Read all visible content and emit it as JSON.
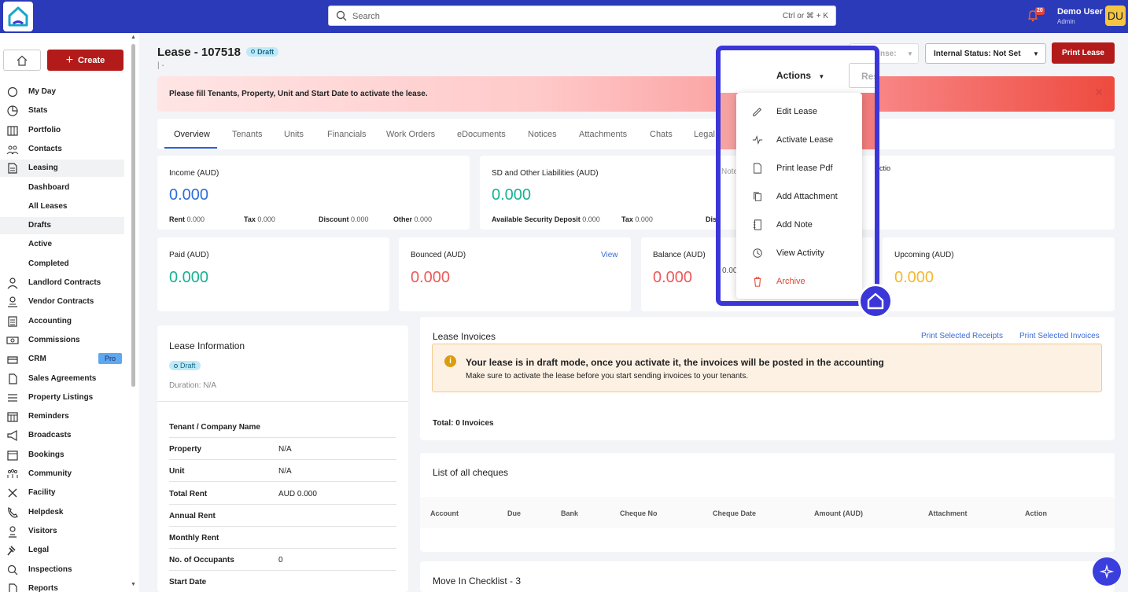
{
  "search": {
    "placeholder": "Search",
    "shortcut": "Ctrl or ⌘ + K"
  },
  "notifications": {
    "count": "20"
  },
  "user": {
    "name": "Demo User",
    "role": "Admin",
    "initials": "DU"
  },
  "sidebar": {
    "create_label": "Create",
    "items": [
      {
        "label": "My Day",
        "icon": "sun-icon"
      },
      {
        "label": "Stats",
        "icon": "pie-chart-icon"
      },
      {
        "label": "Portfolio",
        "icon": "building-icon"
      },
      {
        "label": "Contacts",
        "icon": "contacts-icon"
      },
      {
        "label": "Leasing",
        "icon": "document-icon",
        "selected": true
      },
      {
        "label": "Dashboard"
      },
      {
        "label": "All Leases"
      },
      {
        "label": "Drafts",
        "selected": true
      },
      {
        "label": "Active"
      },
      {
        "label": "Completed"
      },
      {
        "label": "Landlord Contracts",
        "icon": "landlord-icon"
      },
      {
        "label": "Vendor Contracts",
        "icon": "vendor-icon"
      },
      {
        "label": "Accounting",
        "icon": "ledger-icon"
      },
      {
        "label": "Commissions",
        "icon": "cash-icon"
      },
      {
        "label": "CRM",
        "icon": "crm-icon",
        "badge": "Pro"
      },
      {
        "label": "Sales Agreements",
        "icon": "file-icon"
      },
      {
        "label": "Property Listings",
        "icon": "list-icon"
      },
      {
        "label": "Reminders",
        "icon": "calendar-icon"
      },
      {
        "label": "Broadcasts",
        "icon": "megaphone-icon"
      },
      {
        "label": "Bookings",
        "icon": "booking-icon"
      },
      {
        "label": "Community",
        "icon": "community-icon"
      },
      {
        "label": "Facility",
        "icon": "tools-icon"
      },
      {
        "label": "Helpdesk",
        "icon": "phone-icon"
      },
      {
        "label": "Visitors",
        "icon": "visitor-icon"
      },
      {
        "label": "Legal",
        "icon": "gavel-icon"
      },
      {
        "label": "Inspections",
        "icon": "magnifier-icon"
      },
      {
        "label": "Reports",
        "icon": "report-icon"
      }
    ]
  },
  "header": {
    "title": "Lease - 107518",
    "status": "Draft",
    "subtitle": "| -",
    "license_label": "nse:",
    "internal_status": "Internal Status: Not Set",
    "print_label": "Print Lease",
    "actions_label": "Actions",
    "res_label": "Res"
  },
  "alert": {
    "text": "Please fill Tenants, Property, Unit and Start Date to activate the lease."
  },
  "tabs": [
    "Overview",
    "Tenants",
    "Units",
    "Financials",
    "Work Orders",
    "eDocuments",
    "Notices",
    "Attachments",
    "Chats",
    "Legal"
  ],
  "income": {
    "title": "Income (AUD)",
    "value": "0.000",
    "rent_label": "Rent",
    "rent": "0.000",
    "tax_label": "Tax",
    "tax": "0.000",
    "discount_label": "Discount",
    "discount": "0.000",
    "other_label": "Other",
    "other": "0.000"
  },
  "sd": {
    "title": "SD and Other Liabilities (AUD)",
    "value": "0.000",
    "available_label": "Available Security Deposit",
    "available": "0.000",
    "tax_label": "Tax",
    "tax": "0.000",
    "dis_label": "Dis"
  },
  "third": {
    "note_fragment": "Note",
    "action_fragment": "ctio",
    "paren_fragment": ")"
  },
  "paid": {
    "title": "Paid (AUD)",
    "value": "0.000"
  },
  "bounced": {
    "title": "Bounced (AUD)",
    "value": "0.000",
    "view": "View"
  },
  "balance": {
    "title": "Balance (AUD)",
    "value": "0.000",
    "frag": "0.00"
  },
  "upcoming": {
    "title": "Upcoming (AUD)",
    "value": "0.000"
  },
  "lease_info": {
    "title": "Lease Information",
    "status": "Draft",
    "duration": "Duration: N/A",
    "rows": [
      {
        "k": "Tenant / Company Name",
        "v": ""
      },
      {
        "k": "Property",
        "v": "N/A"
      },
      {
        "k": "Unit",
        "v": "N/A"
      },
      {
        "k": "Total Rent",
        "v": "AUD 0.000"
      },
      {
        "k": "Annual Rent",
        "v": ""
      },
      {
        "k": "Monthly Rent",
        "v": ""
      },
      {
        "k": "No. of Occupants",
        "v": "0"
      },
      {
        "k": "Start Date",
        "v": ""
      }
    ]
  },
  "invoices": {
    "title": "Lease Invoices",
    "print_receipts": "Print Selected Receipts",
    "print_invoices": "Print Selected Invoices",
    "alert_title": "Your lease is in draft mode, once you activate it, the invoices will be posted in the accounting",
    "alert_sub": "Make sure to activate the lease before you start sending invoices to your tenants.",
    "total": "Total: 0 Invoices"
  },
  "cheques": {
    "title": "List of all cheques",
    "columns": [
      "Account",
      "Due",
      "Bank",
      "Cheque No",
      "Cheque Date",
      "Amount (AUD)",
      "Attachment",
      "Action"
    ]
  },
  "checklist": {
    "title": "Move In Checklist - 3"
  },
  "menu": {
    "items": [
      {
        "label": "Edit Lease",
        "icon": "pencil-icon"
      },
      {
        "label": "Activate Lease",
        "icon": "pulse-icon"
      },
      {
        "label": "Print lease Pdf",
        "icon": "pdf-icon"
      },
      {
        "label": "Add Attachment",
        "icon": "copy-icon"
      },
      {
        "label": "Add Note",
        "icon": "notebook-icon"
      },
      {
        "label": "View Activity",
        "icon": "clock-icon"
      },
      {
        "label": "Archive",
        "icon": "trash-icon",
        "danger": true
      }
    ]
  }
}
